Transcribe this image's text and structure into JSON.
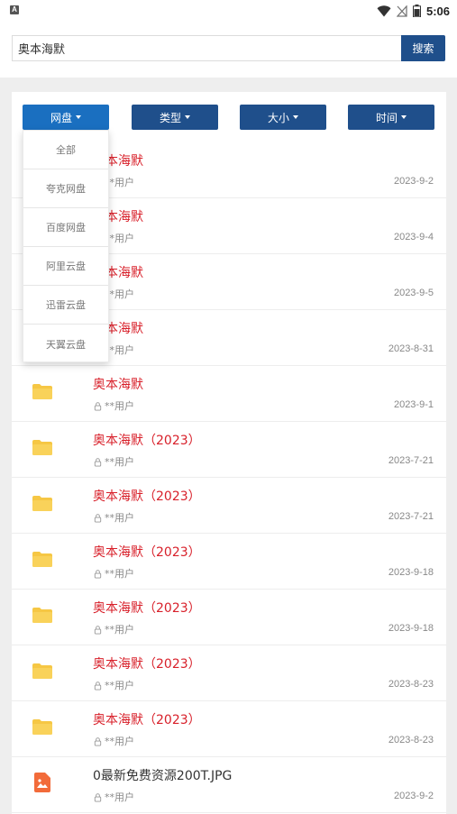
{
  "status_bar": {
    "time": "5:06",
    "app_icon": "A"
  },
  "search": {
    "value": "奥本海默",
    "button_label": "搜索"
  },
  "filters": [
    {
      "label": "网盘"
    },
    {
      "label": "类型"
    },
    {
      "label": "大小"
    },
    {
      "label": "时间"
    }
  ],
  "dropdown": {
    "items": [
      "全部",
      "夸克网盘",
      "百度网盘",
      "阿里云盘",
      "迅雷云盘",
      "天翼云盘"
    ]
  },
  "results": [
    {
      "title": "奥本海默",
      "user": "**用户",
      "date": "2023-9-2",
      "icon": "folder-icon",
      "highlight": true
    },
    {
      "title": "奥本海默",
      "user": "**用户",
      "date": "2023-9-4",
      "icon": "folder-icon",
      "highlight": true
    },
    {
      "title": "奥本海默",
      "user": "**用户",
      "date": "2023-9-5",
      "icon": "folder-icon",
      "highlight": true
    },
    {
      "title": "奥本海默",
      "user": "**用户",
      "date": "2023-8-31",
      "icon": "folder-icon",
      "highlight": true
    },
    {
      "title": "奥本海默",
      "user": "**用户",
      "date": "2023-9-1",
      "icon": "folder-icon",
      "highlight": true
    },
    {
      "title": "奥本海默（2023）",
      "user": "**用户",
      "date": "2023-7-21",
      "icon": "folder-icon",
      "highlight": true
    },
    {
      "title": "奥本海默（2023）",
      "user": "**用户",
      "date": "2023-7-21",
      "icon": "folder-icon",
      "highlight": true
    },
    {
      "title": "奥本海默（2023）",
      "user": "**用户",
      "date": "2023-9-18",
      "icon": "folder-icon",
      "highlight": true
    },
    {
      "title": "奥本海默（2023）",
      "user": "**用户",
      "date": "2023-9-18",
      "icon": "folder-icon",
      "highlight": true
    },
    {
      "title": "奥本海默（2023）",
      "user": "**用户",
      "date": "2023-8-23",
      "icon": "folder-icon",
      "highlight": true
    },
    {
      "title": "奥本海默（2023）",
      "user": "**用户",
      "date": "2023-8-23",
      "icon": "folder-icon",
      "highlight": true
    },
    {
      "title": "0最新免费资源200T.JPG",
      "user": "**用户",
      "date": "2023-9-2",
      "icon": "image-file-icon",
      "highlight": false
    }
  ],
  "colors": {
    "primary": "#1f4f8b",
    "active_filter": "#1a6fc0",
    "title_red": "#d8202a",
    "folder_yellow": "#f6c744",
    "image_orange": "#f26b3a"
  }
}
